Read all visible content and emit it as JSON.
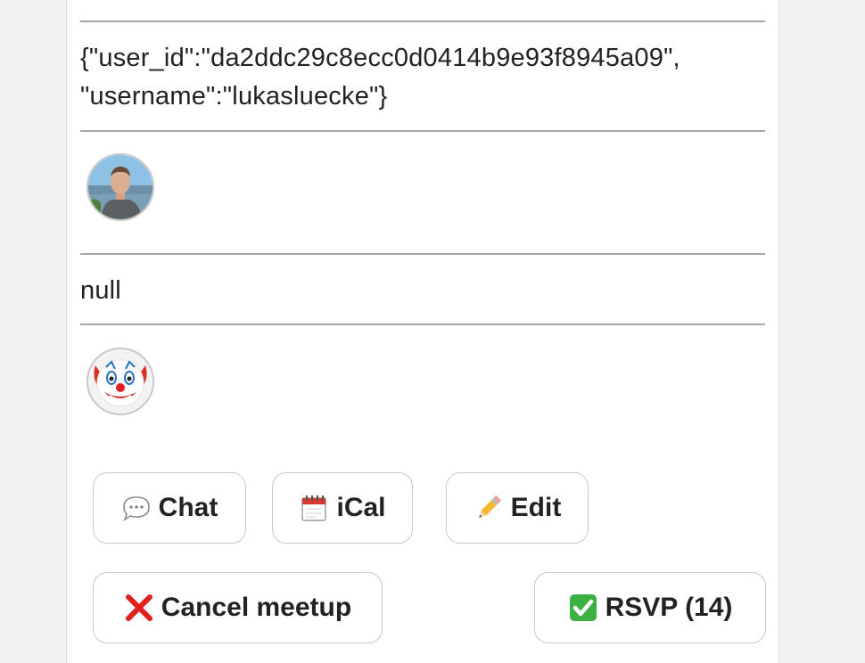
{
  "participant": {
    "json_text": "{\"user_id\":\"da2ddc29c8ecc0d0414b9e93f8945a09\", \"username\":\"lukasluecke\"}",
    "avatar_icon": "user-photo-avatar",
    "null_value": "null",
    "emoji_icon": "clown-face-icon"
  },
  "actions": {
    "chat_label": "Chat",
    "chat_icon": "speech-bubble-icon",
    "ical_label": "iCal",
    "ical_icon": "calendar-icon",
    "edit_label": "Edit",
    "edit_icon": "pencil-icon",
    "cancel_label": "Cancel meetup",
    "cancel_icon": "red-cross-icon",
    "rsvp_label": "RSVP (14)",
    "rsvp_icon": "green-check-icon"
  },
  "colors": {
    "cancel_red": "#e0201f",
    "check_green": "#3cb043",
    "divider": "#a6a6a6"
  }
}
